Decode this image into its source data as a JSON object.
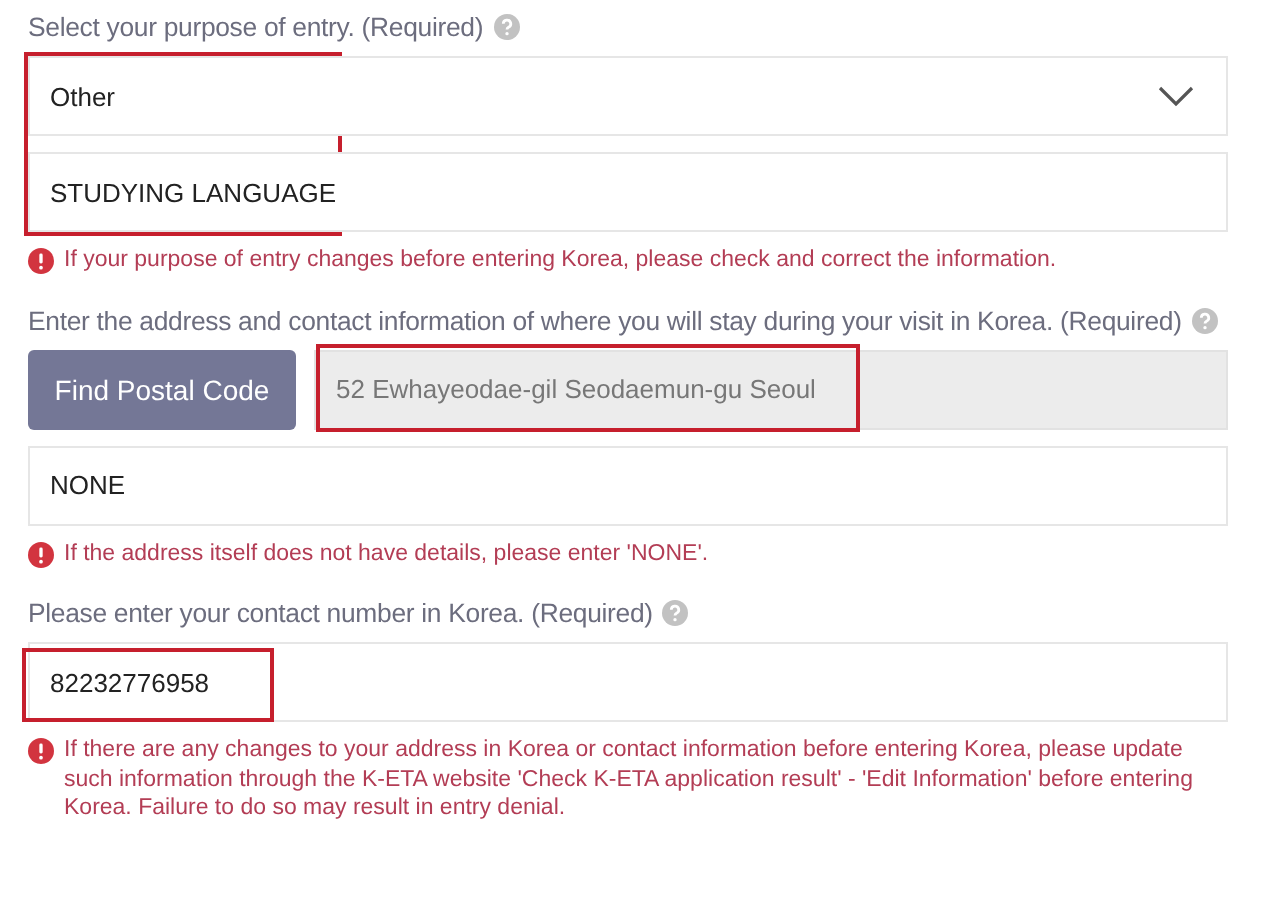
{
  "sections": [
    {
      "label": "Select your purpose of entry. (Required)",
      "highlighted": true,
      "fields": [
        {
          "kind": "select",
          "value": "Other",
          "disabled": false,
          "highlighted": false
        },
        {
          "kind": "text",
          "value": "STUDYING LANGUAGE",
          "disabled": false,
          "highlighted": false
        }
      ],
      "error": "If your purpose of entry changes before entering Korea, please check and correct the information."
    },
    {
      "label": "Enter the address and contact information of where you will stay during your visit in Korea. (Required)",
      "fields": [
        {
          "kind": "address",
          "button": "Find Postal Code",
          "value": "52 Ewhayeodae-gil Seodaemun-gu Seoul",
          "disabled": true,
          "highlighted": true
        },
        {
          "kind": "text",
          "value": "NONE",
          "disabled": false,
          "highlighted": false
        }
      ],
      "error": "If the address itself does not have details, please enter 'NONE'."
    },
    {
      "label": "Please enter your contact number in Korea. (Required)",
      "fields": [
        {
          "kind": "text",
          "value": "82232776958",
          "disabled": false,
          "highlighted": true
        }
      ],
      "error": "If there are any changes to your address in Korea or contact information before entering Korea, please update such information through the K-ETA website 'Check K-ETA application result' - 'Edit Information' before entering Korea. Failure to do so may result in entry denial."
    }
  ]
}
